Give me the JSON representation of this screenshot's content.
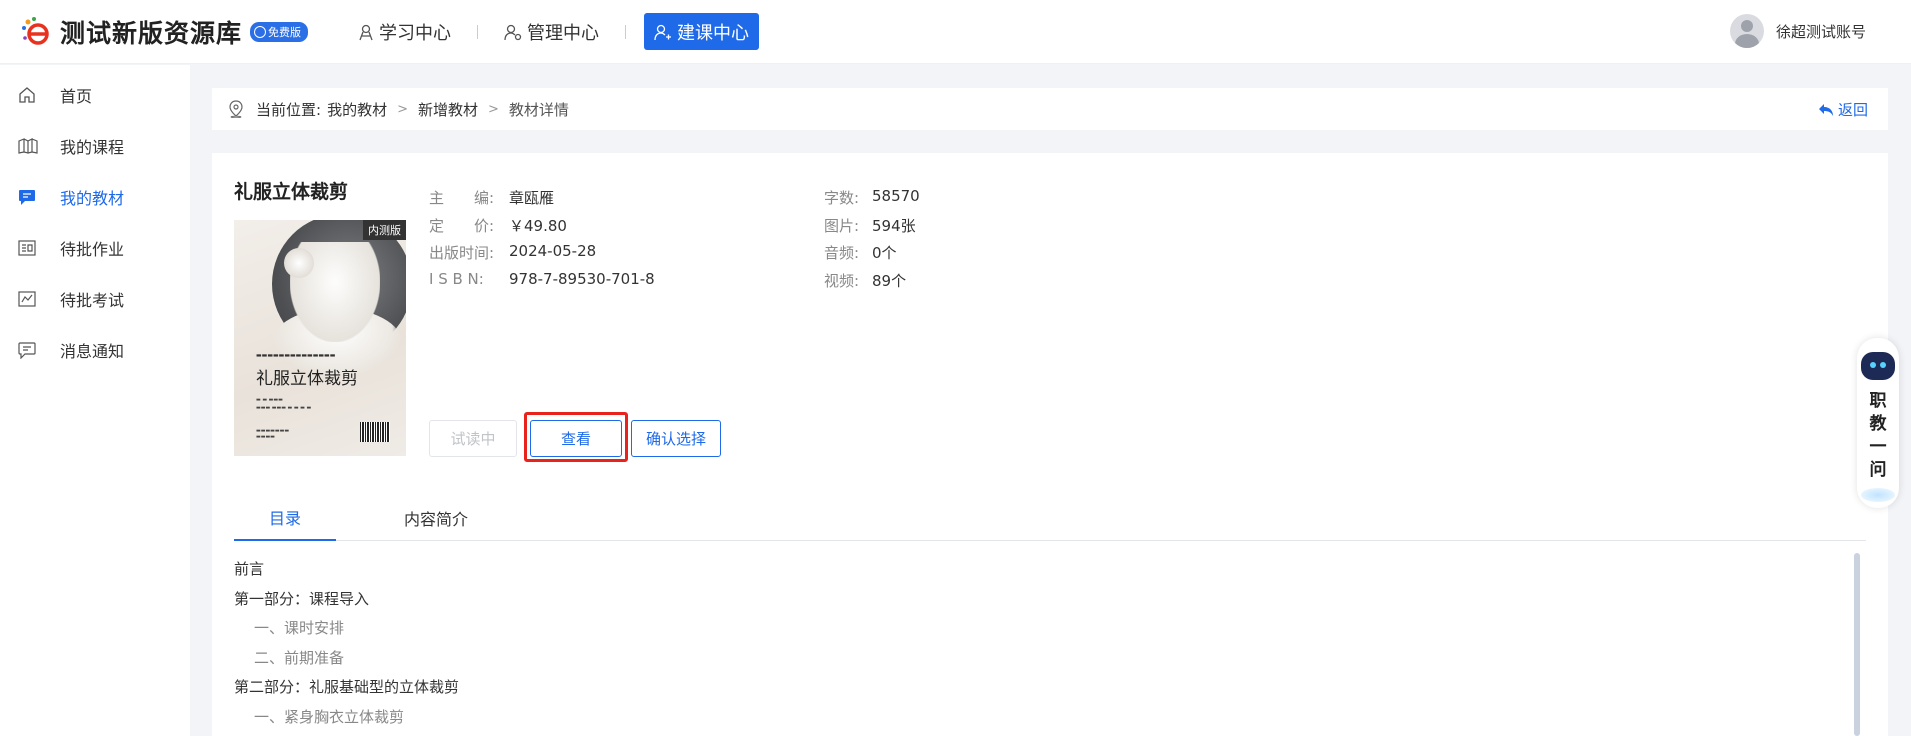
{
  "header": {
    "logo_title": "测试新版资源库",
    "free_badge": "免费版",
    "nav": [
      {
        "label": "学习中心"
      },
      {
        "label": "管理中心"
      },
      {
        "label": "建课中心"
      }
    ],
    "user_name": "徐超测试账号"
  },
  "sidebar": {
    "items": [
      {
        "label": "首页",
        "icon": "home-icon"
      },
      {
        "label": "我的课程",
        "icon": "book-icon"
      },
      {
        "label": "我的教材",
        "icon": "message-icon"
      },
      {
        "label": "待批作业",
        "icon": "homework-icon"
      },
      {
        "label": "待批考试",
        "icon": "exam-icon"
      },
      {
        "label": "消息通知",
        "icon": "chat-icon"
      }
    ],
    "active_index": 2
  },
  "breadcrumb": {
    "prefix": "当前位置:",
    "items": [
      "我的教材",
      "新增教材",
      "教材详情"
    ],
    "back_label": "返回"
  },
  "book": {
    "title": "礼服立体裁剪",
    "cover_badge": "内测版",
    "meta_left": [
      {
        "key": "主　　编:",
        "value": "章瓯雁"
      },
      {
        "key": "定　　价:",
        "value": "￥49.80"
      },
      {
        "key": "出版时间:",
        "value": "2024-05-28"
      },
      {
        "key": "I S B N:",
        "value": "978-7-89530-701-8"
      }
    ],
    "meta_right": [
      {
        "key": "字数:",
        "value": "58570"
      },
      {
        "key": "图片:",
        "value": "594张"
      },
      {
        "key": "音频:",
        "value": "0个"
      },
      {
        "key": "视频:",
        "value": "89个"
      }
    ]
  },
  "buttons": {
    "trial": "试读中",
    "view": "查看",
    "confirm": "确认选择"
  },
  "tabs": [
    {
      "label": "目录"
    },
    {
      "label": "内容简介"
    }
  ],
  "toc": [
    {
      "level": 1,
      "text": "前言"
    },
    {
      "level": 1,
      "text": "第一部分：课程导入"
    },
    {
      "level": 2,
      "text": "一、课时安排"
    },
    {
      "level": 2,
      "text": "二、前期准备"
    },
    {
      "level": 1,
      "text": "第二部分：礼服基础型的立体裁剪"
    },
    {
      "level": 2,
      "text": "一、紧身胸衣立体裁剪"
    }
  ],
  "float_assistant": {
    "chars": [
      "职",
      "教",
      "一",
      "问"
    ]
  },
  "colors": {
    "primary": "#1f6ae8",
    "highlight": "#e8231d"
  }
}
